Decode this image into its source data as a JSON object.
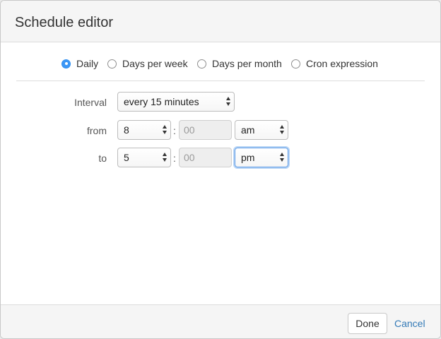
{
  "dialog": {
    "title": "Schedule editor"
  },
  "schedule_type": {
    "options": [
      {
        "label": "Daily",
        "checked": true
      },
      {
        "label": "Days per week",
        "checked": false
      },
      {
        "label": "Days per month",
        "checked": false
      },
      {
        "label": "Cron expression",
        "checked": false
      }
    ]
  },
  "form": {
    "interval": {
      "label": "Interval",
      "value": "every 15 minutes"
    },
    "from": {
      "label": "from",
      "hour": "8",
      "separator": ":",
      "minutes": "00",
      "ampm": "am"
    },
    "to": {
      "label": "to",
      "hour": "5",
      "separator": ":",
      "minutes": "00",
      "ampm": "pm"
    }
  },
  "footer": {
    "done_label": "Done",
    "cancel_label": "Cancel"
  },
  "colors": {
    "accent": "#3b96f5",
    "link": "#337ab7",
    "header_bg": "#f5f5f5"
  }
}
